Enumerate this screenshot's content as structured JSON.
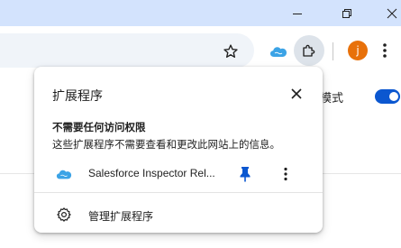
{
  "browser": {
    "profile_initial": "j"
  },
  "page": {
    "partial_setting_text": "者模式"
  },
  "extensions_popup": {
    "title": "扩展程序",
    "section_heading": "不需要任何访问权限",
    "section_description": "这些扩展程序不需要查看和更改此网站上的信息。",
    "extensions": [
      {
        "name": "Salesforce Inspector Rel...",
        "icon": "salesforce-cloud-icon",
        "pinned": true
      }
    ],
    "manage_label": "管理扩展程序"
  },
  "colors": {
    "titlebar": "#d3e3fd",
    "accent_blue": "#0b57d0",
    "avatar": "#e8710a",
    "salesforce_cloud": "#3ba3e6"
  }
}
